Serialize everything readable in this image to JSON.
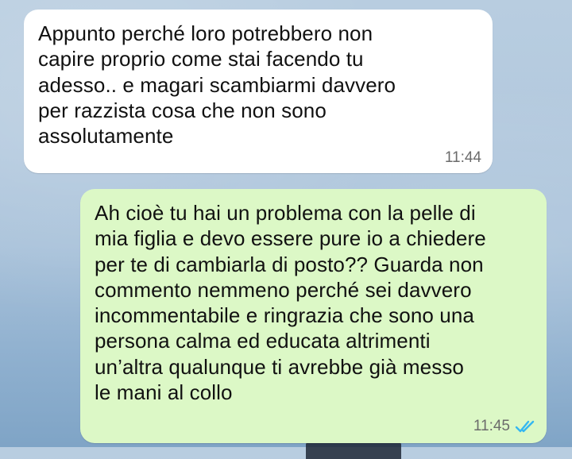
{
  "conversation": {
    "messages": [
      {
        "direction": "incoming",
        "text": "Appunto perché loro potrebbero non\ncapire proprio come stai facendo tu\nadesso.. e magari scambiarmi davvero\nper razzista cosa che non sono\nassolutamente",
        "time": "11:44"
      },
      {
        "direction": "outgoing",
        "text": "Ah cioè tu hai un problema con la pelle di\nmia figlia e devo essere pure io a chiedere\nper te di cambiarla di posto?? Guarda non\ncommento nemmeno perché sei davvero\nincommentabile e ringrazia che sono una\npersona calma ed educata altrimenti\nun’altra qualunque ti avrebbe già messo\nle mani al collo",
        "time": "11:45",
        "status_icon": "double-check-read-icon",
        "status_color": "#34b7f1"
      }
    ]
  },
  "colors": {
    "incoming_bubble": "#ffffff",
    "outgoing_bubble": "#dcf8c6",
    "text": "#111111",
    "timestamp": "#6b6b6b"
  }
}
